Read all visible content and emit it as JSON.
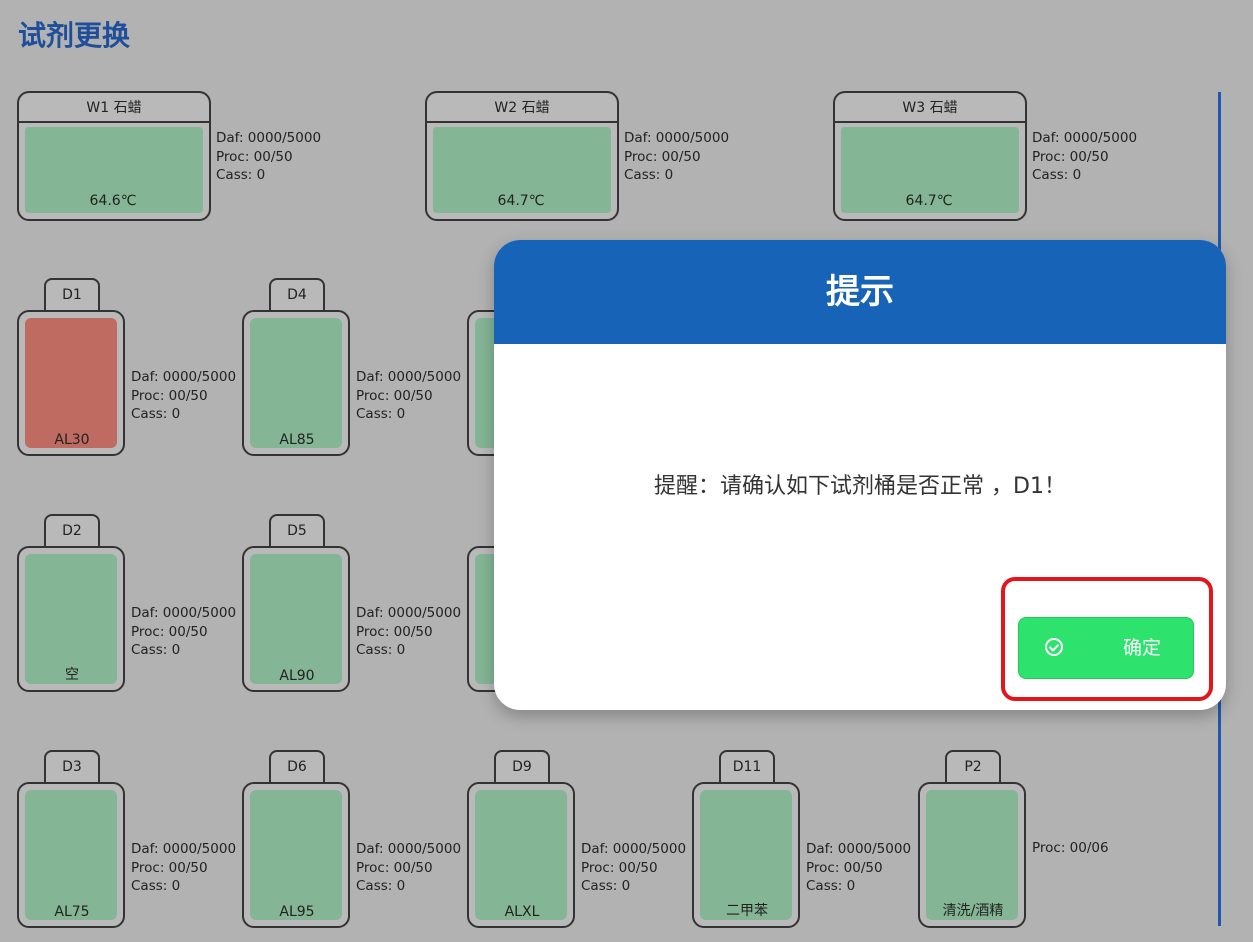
{
  "page_title": "试剂更换",
  "w_tanks": [
    {
      "name": "W1 石蜡",
      "temp": "64.6℃",
      "daf": "Daf:  0000/5000",
      "proc": "Proc: 00/50",
      "cass": "Cass: 0"
    },
    {
      "name": "W2 石蜡",
      "temp": "64.7℃",
      "daf": "Daf:  0000/5000",
      "proc": "Proc: 00/50",
      "cass": "Cass: 0"
    },
    {
      "name": "W3 石蜡",
      "temp": "64.7℃",
      "daf": "Daf:  0000/5000",
      "proc": "Proc: 00/50",
      "cass": "Cass: 0"
    }
  ],
  "d_tanks": [
    {
      "id": "D1",
      "label": "AL30",
      "status": "alert",
      "daf": "Daf:  0000/5000",
      "proc": "Proc: 00/50",
      "cass": "Cass: 0"
    },
    {
      "id": "D4",
      "label": "AL85",
      "status": "ok",
      "daf": "Daf:  0000/5000",
      "proc": "Proc: 00/50",
      "cass": "Cass: 0"
    },
    {
      "id": "D2",
      "label": "空",
      "status": "ok",
      "daf": "Daf:  0000/5000",
      "proc": "Proc: 00/50",
      "cass": "Cass: 0"
    },
    {
      "id": "D5",
      "label": "AL90",
      "status": "ok",
      "daf": "Daf:  0000/5000",
      "proc": "Proc: 00/50",
      "cass": "Cass: 0"
    },
    {
      "id": "D3",
      "label": "AL75",
      "status": "ok",
      "daf": "Daf:  0000/5000",
      "proc": "Proc: 00/50",
      "cass": "Cass: 0"
    },
    {
      "id": "D6",
      "label": "AL95",
      "status": "ok",
      "daf": "Daf:  0000/5000",
      "proc": "Proc: 00/50",
      "cass": "Cass: 0"
    },
    {
      "id": "D9",
      "label": "ALXL",
      "status": "ok",
      "daf": "Daf:  0000/5000",
      "proc": "Proc: 00/50",
      "cass": "Cass: 0"
    },
    {
      "id": "D11",
      "label": "二甲苯",
      "status": "ok",
      "daf": "Daf:  0000/5000",
      "proc": "Proc: 00/50",
      "cass": "Cass: 0"
    },
    {
      "id": "P2",
      "label": "清洗/酒精",
      "status": "ok",
      "proc": "Proc: 00/06"
    }
  ],
  "dialog": {
    "title": "提示",
    "message": "提醒：请确认如下试剂桶是否正常 ，D1！",
    "ok_label": "确定"
  },
  "colors": {
    "ok_fill": "#84b595",
    "alert_fill": "#bf6b62",
    "dialog_header": "#1763b8",
    "ok_button": "#2ee26e",
    "highlight": "#e3161d"
  }
}
